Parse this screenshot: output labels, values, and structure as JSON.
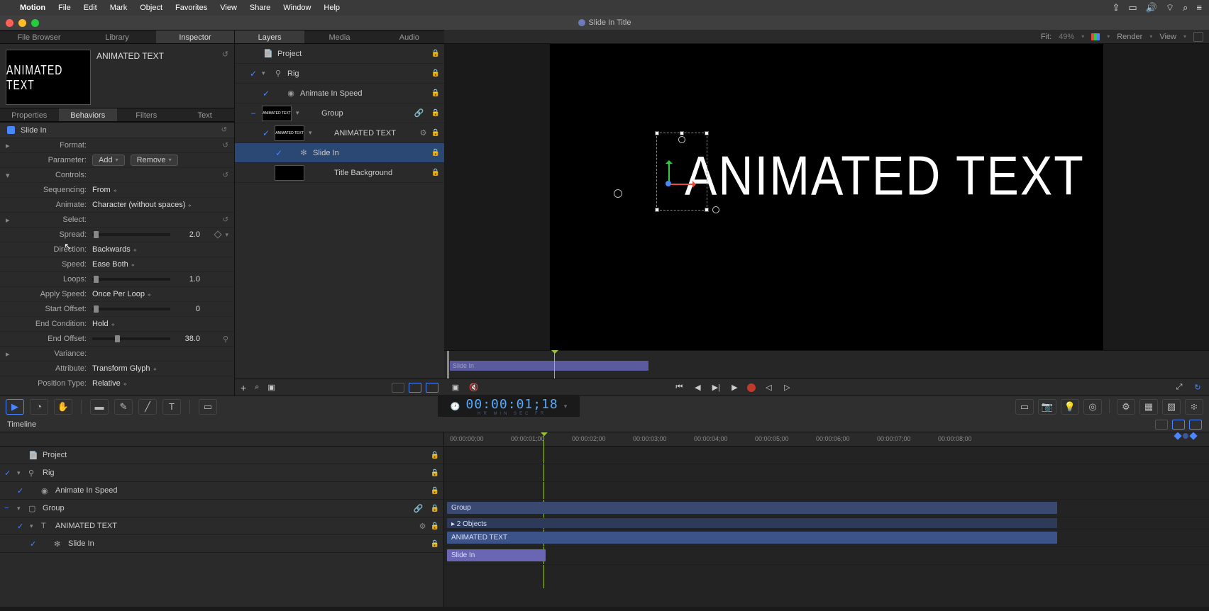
{
  "menubar": {
    "app": "Motion",
    "items": [
      "File",
      "Edit",
      "Mark",
      "Object",
      "Favorites",
      "View",
      "Share",
      "Window",
      "Help"
    ]
  },
  "window": {
    "title": "Slide In Title"
  },
  "canvasToolbar": {
    "fit": "Fit:",
    "fitPct": "49%",
    "render": "Render",
    "view": "View"
  },
  "leftTabs": [
    "File Browser",
    "Library",
    "Inspector"
  ],
  "leftTabsActive": 2,
  "insTabs": [
    "Properties",
    "Behaviors",
    "Filters",
    "Text"
  ],
  "insTabsActive": 1,
  "previewTitle": "ANIMATED TEXT",
  "thumbText": "ANIMATED TEXT",
  "slideIn": {
    "name": "Slide In",
    "format": "Format:",
    "parameter": "Parameter:",
    "add": "Add",
    "remove": "Remove",
    "controls": "Controls:",
    "rows": {
      "sequencing": {
        "l": "Sequencing:",
        "v": "From"
      },
      "animate": {
        "l": "Animate:",
        "v": "Character (without spaces)"
      },
      "select": {
        "l": "Select:"
      },
      "spread": {
        "l": "Spread:",
        "v": "2.0"
      },
      "direction": {
        "l": "Direction:",
        "v": "Backwards"
      },
      "speed": {
        "l": "Speed:",
        "v": "Ease Both"
      },
      "loops": {
        "l": "Loops:",
        "v": "1.0"
      },
      "applySpeed": {
        "l": "Apply Speed:",
        "v": "Once Per Loop"
      },
      "startOffset": {
        "l": "Start Offset:",
        "v": "0"
      },
      "endCond": {
        "l": "End Condition:",
        "v": "Hold"
      },
      "endOffset": {
        "l": "End Offset:",
        "v": "38.0"
      },
      "variance": {
        "l": "Variance:"
      },
      "attribute": {
        "l": "Attribute:",
        "v": "Transform Glyph"
      },
      "posType": {
        "l": "Position Type:",
        "v": "Relative"
      }
    }
  },
  "midTabs": [
    "Layers",
    "Media",
    "Audio"
  ],
  "midTabsActive": 0,
  "layers": [
    {
      "name": "Project",
      "chk": "",
      "icon": "doc",
      "indent": 0
    },
    {
      "name": "Rig",
      "chk": "✓",
      "icon": "rig",
      "indent": 1,
      "twist": "▾"
    },
    {
      "name": "Animate In Speed",
      "chk": "✓",
      "icon": "slider",
      "indent": 2
    },
    {
      "name": "Group",
      "chk": "−",
      "thumb": true,
      "indent": 1,
      "twist": "▾",
      "link": true
    },
    {
      "name": "ANIMATED TEXT",
      "chk": "✓",
      "thumb": true,
      "indent": 2,
      "twist": "▾",
      "gear": true
    },
    {
      "name": "Slide In",
      "chk": "✓",
      "icon": "gear",
      "indent": 3,
      "selected": true
    },
    {
      "name": "Title Background",
      "chk": "",
      "thumb": "blank",
      "indent": 2
    }
  ],
  "canvasText": "ANIMATED TEXT",
  "miniTl": {
    "label": "Slide In"
  },
  "timecode": "00:00:01;18",
  "tcUnits": "HR  MIN  SEC  FR",
  "timeline": {
    "header": "Timeline",
    "ruler": [
      "00:00:00;00",
      "00:00:01;00",
      "00:00:02;00",
      "00:00:03;00",
      "00:00:04;00",
      "00:00:05;00",
      "00:00:06;00",
      "00:00:07;00",
      "00:00:08;00"
    ],
    "rows": [
      {
        "name": "Project",
        "chk": "",
        "icon": "doc"
      },
      {
        "name": "Rig",
        "chk": "✓",
        "icon": "rig",
        "twist": "▾"
      },
      {
        "name": "Animate In Speed",
        "chk": "✓",
        "icon": "slider",
        "indent": 1
      },
      {
        "name": "Group",
        "chk": "−",
        "icon": "group",
        "twist": "▾",
        "link": true
      },
      {
        "name": "ANIMATED TEXT",
        "chk": "✓",
        "icon": "text",
        "twist": "▾",
        "indent": 1,
        "gear": true
      },
      {
        "name": "Slide In",
        "chk": "✓",
        "icon": "gear",
        "indent": 2
      }
    ],
    "bars": {
      "group": "Group",
      "sub": "▸ 2 Objects",
      "text": "ANIMATED TEXT",
      "slide": "Slide In"
    }
  }
}
